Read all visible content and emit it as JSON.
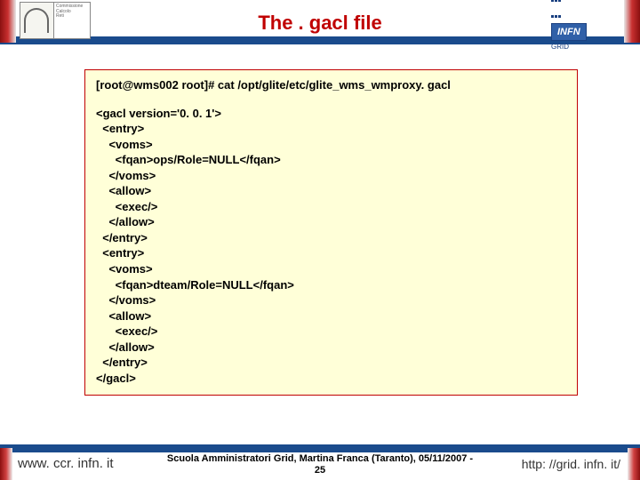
{
  "header": {
    "title": "The . gacl file"
  },
  "code": {
    "command": "[root@wms002 root]# cat /opt/glite/etc/glite_wms_wmproxy. gacl",
    "lines": [
      "<gacl version='0. 0. 1'>",
      "  <entry>",
      "    <voms>",
      "      <fqan>ops/Role=NULL</fqan>",
      "    </voms>",
      "    <allow>",
      "      <exec/>",
      "    </allow>",
      "  </entry>",
      "  <entry>",
      "    <voms>",
      "      <fqan>dteam/Role=NULL</fqan>",
      "    </voms>",
      "    <allow>",
      "      <exec/>",
      "    </allow>",
      "  </entry>",
      "</gacl>"
    ]
  },
  "footer": {
    "left": "www. ccr. infn. it",
    "center_line1": "Scuola Amministratori Grid, Martina Franca (Taranto), 05/11/2007  -",
    "center_line2": "25",
    "right": "http: //grid. infn. it/"
  },
  "logos": {
    "left_alt": "CCR logo",
    "right_main": "INFN",
    "right_sub": "GRID"
  }
}
